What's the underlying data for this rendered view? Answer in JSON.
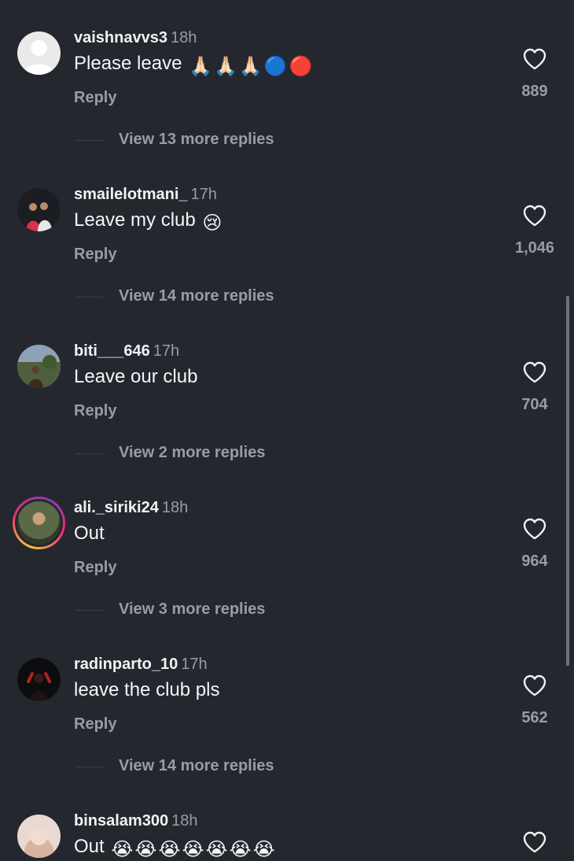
{
  "comments": [
    {
      "username": "vaishnavvs3",
      "time": "18h",
      "text": "Please leave",
      "emoji": [
        "🙏🏻",
        "🙏🏻",
        "🙏🏻",
        "🔵",
        "🔴"
      ],
      "reply": "Reply",
      "likes": "889",
      "view_more": "View 13 more replies"
    },
    {
      "username": "smailelotmani_",
      "time": "17h",
      "text": "Leave my club",
      "emoji": [
        "😢"
      ],
      "reply": "Reply",
      "likes": "1,046",
      "view_more": "View 14 more replies"
    },
    {
      "username": "biti___646",
      "time": "17h",
      "text": "Leave our club",
      "emoji": [],
      "reply": "Reply",
      "likes": "704",
      "view_more": "View 2 more replies"
    },
    {
      "username": "ali._siriki24",
      "time": "18h",
      "text": "Out",
      "emoji": [],
      "reply": "Reply",
      "likes": "964",
      "view_more": "View 3 more replies"
    },
    {
      "username": "radinparto_10",
      "time": "17h",
      "text": "leave the club pls",
      "emoji": [],
      "reply": "Reply",
      "likes": "562",
      "view_more": "View 14 more replies"
    },
    {
      "username": "binsalam300",
      "time": "18h",
      "text": "Out",
      "emoji": [
        "😭",
        "😭",
        "😭",
        "😭",
        "😭",
        "😭",
        "😭"
      ]
    }
  ],
  "icons": {
    "like": "heart-outline-icon"
  },
  "colors": {
    "background": "#25272e",
    "text": "#f2f2f4",
    "muted": "#9a9ca3"
  }
}
